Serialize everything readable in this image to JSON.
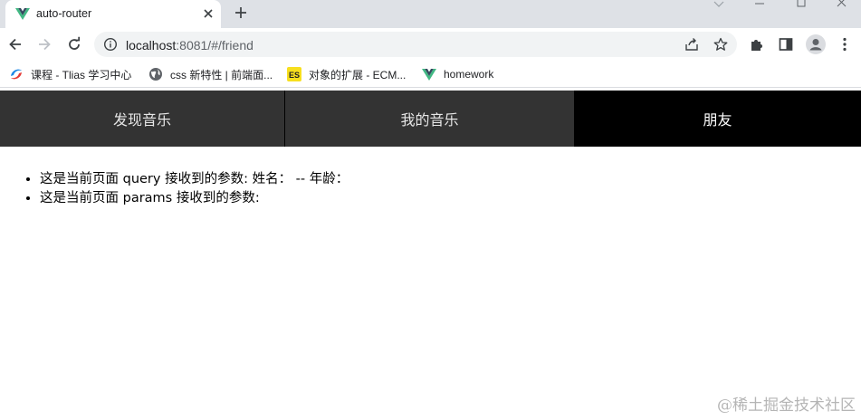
{
  "browser": {
    "tab": {
      "title": "auto-router"
    },
    "address": {
      "host": "localhost",
      "port_path": ":8081/#/friend"
    },
    "bookmarks": [
      {
        "label": "课程 - Tlias 学习中心",
        "icon": "tlias-icon"
      },
      {
        "label": "css 新特性 | 前端面...",
        "icon": "globe-icon"
      },
      {
        "label": "对象的扩展 - ECM...",
        "icon": "es-icon",
        "icon_text": "ES"
      },
      {
        "label": "homework",
        "icon": "vue-icon"
      }
    ]
  },
  "nav": {
    "items": [
      {
        "label": "发现音乐",
        "active": false
      },
      {
        "label": "我的音乐",
        "active": false
      },
      {
        "label": "朋友",
        "active": true
      }
    ]
  },
  "content": {
    "items": [
      "这是当前页面 query 接收到的参数: 姓名：  -- 年龄：",
      "这是当前页面 params 接收到的参数:"
    ]
  },
  "watermark": "@稀土掘金技术社区",
  "colors": {
    "nav_bg": "#333333",
    "nav_active_bg": "#000000",
    "vue_green": "#41b883",
    "vue_dark": "#35495e",
    "es_yellow": "#f7df1e"
  }
}
